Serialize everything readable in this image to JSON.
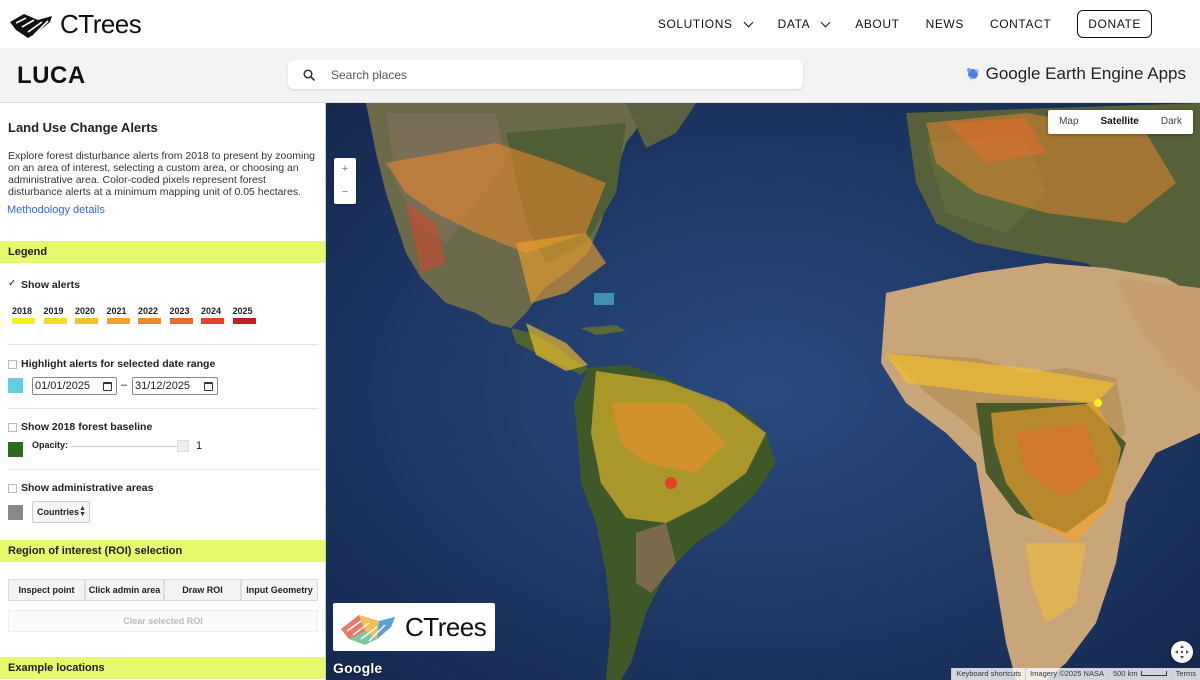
{
  "nav": {
    "brand": "CTrees",
    "items": [
      {
        "label": "SOLUTIONS",
        "dropdown": true
      },
      {
        "label": "DATA",
        "dropdown": true
      },
      {
        "label": "ABOUT",
        "dropdown": false
      },
      {
        "label": "NEWS",
        "dropdown": false
      },
      {
        "label": "CONTACT",
        "dropdown": false
      }
    ],
    "donate": "DONATE"
  },
  "header": {
    "app_title": "LUCA",
    "search_placeholder": "Search places",
    "gee_label": "Google Earth Engine Apps"
  },
  "sidebar": {
    "title": "Land Use Change Alerts",
    "description": "Explore forest disturbance alerts from 2018 to present by zooming on an area of interest, selecting a custom area, or choosing an administrative area. Color-coded pixels represent forest disturbance alerts at a minimum mapping unit of 0.05 hectares.",
    "methodology_link": "Methodology details",
    "legend_header": "Legend",
    "show_alerts": {
      "label": "Show alerts",
      "checked": true
    },
    "years": [
      {
        "year": "2018",
        "color": "#f7f01f"
      },
      {
        "year": "2019",
        "color": "#f5dc1e"
      },
      {
        "year": "2020",
        "color": "#f2c12b"
      },
      {
        "year": "2021",
        "color": "#f1a32b"
      },
      {
        "year": "2022",
        "color": "#ee8a2c"
      },
      {
        "year": "2023",
        "color": "#ea6a2a"
      },
      {
        "year": "2024",
        "color": "#e2422a"
      },
      {
        "year": "2025",
        "color": "#c21f22"
      }
    ],
    "highlight": {
      "label": "Highlight alerts for selected date range",
      "checked": false,
      "color": "#5fd0dc"
    },
    "date_from": "01/01/2025",
    "date_sep": "–",
    "date_to": "31/12/2025",
    "baseline": {
      "label": "Show 2018 forest baseline",
      "checked": false,
      "color": "#2e6b1f"
    },
    "opacity_label": "Opacity:",
    "opacity_value": "1",
    "admin": {
      "label": "Show administrative areas",
      "checked": false,
      "color": "#888888"
    },
    "admin_select": "Countries",
    "roi_header": "Region of interest (ROI) selection",
    "roi_buttons": [
      "Inspect point",
      "Click admin area",
      "Draw ROI",
      "Input Geometry"
    ],
    "clear_roi": "Clear selected ROI",
    "examples_header": "Example locations"
  },
  "map": {
    "types": [
      {
        "label": "Map",
        "active": false
      },
      {
        "label": "Satellite",
        "active": true
      },
      {
        "label": "Dark",
        "active": false
      }
    ],
    "zoom_in": "+",
    "zoom_out": "−",
    "logo_text": "CTrees",
    "google": "Google",
    "attribution": [
      "Keyboard shortcuts",
      "Imagery ©2025 NASA",
      "500 km",
      "Terms"
    ]
  }
}
